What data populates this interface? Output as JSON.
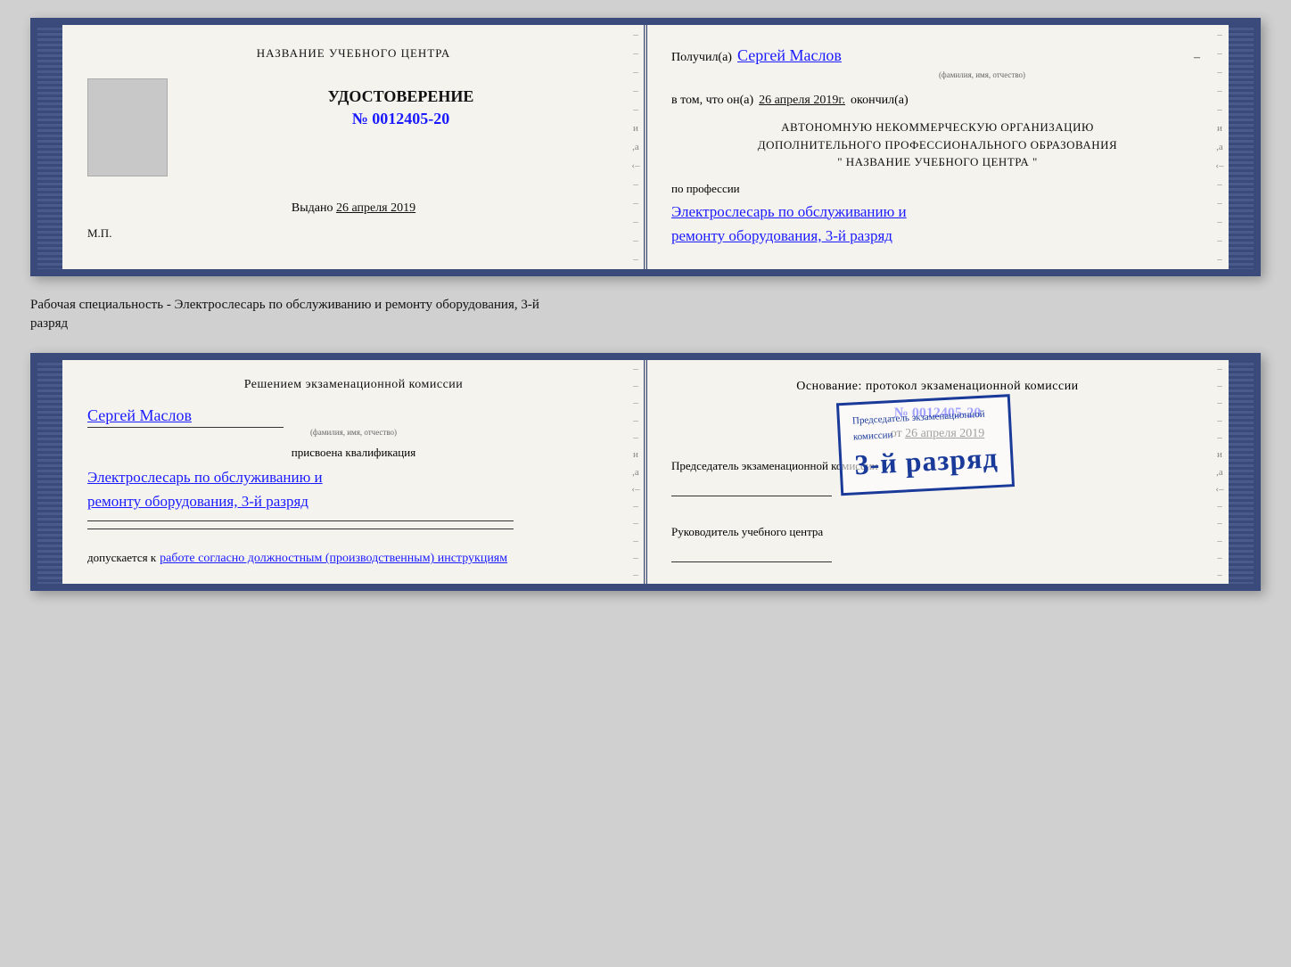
{
  "cert1": {
    "left_page": {
      "header": "НАЗВАНИЕ УЧЕБНОГО ЦЕНТРА",
      "udostoverenie": "УДОСТОВЕРЕНИЕ",
      "number": "№ 0012405-20",
      "vydano_label": "Выдано",
      "vydano_date": "26 апреля 2019",
      "mp": "М.П."
    },
    "right_page": {
      "poluchil_label": "Получил(а)",
      "poluchil_name": "Сергей Маслов",
      "fio_label": "(фамилия, имя, отчество)",
      "vtom_label": "в том, что он(а)",
      "vtom_date": "26 апреля 2019г.",
      "okончил_label": "окончил(а)",
      "org_line1": "АВТОНОМНУЮ НЕКОММЕРЧЕСКУЮ ОРГАНИЗАЦИЮ",
      "org_line2": "ДОПОЛНИТЕЛЬНОГО ПРОФЕССИОНАЛЬНОГО ОБРАЗОВАНИЯ",
      "org_line3": "\"  НАЗВАНИЕ УЧЕБНОГО ЦЕНТРА  \"",
      "po_professii": "по профессии",
      "profession_line1": "Электрослесарь по обслуживанию и",
      "profession_line2": "ремонту оборудования, 3-й разряд"
    }
  },
  "between_text": {
    "line1": "Рабочая специальность - Электрослесарь по обслуживанию и ремонту оборудования, 3-й",
    "line2": "разряд"
  },
  "cert2": {
    "left_page": {
      "resheniem": "Решением экзаменационной комиссии",
      "name": "Сергей Маслов",
      "fio_label": "(фамилия, имя, отчество)",
      "prisvoena": "присвоена квалификация",
      "profession_line1": "Электрослесарь по обслуживанию и",
      "profession_line2": "ремонту оборудования, 3-й разряд",
      "dopuskaetsya": "допускается к",
      "dopusk_text": "работе согласно должностным (производственным) инструкциям"
    },
    "right_page": {
      "osnovanie": "Основание: протокол экзаменационной комиссии",
      "number": "№ 0012405-20",
      "ot_label": "от",
      "ot_date": "26 апреля 2019",
      "predsedatel_label": "Председатель экзаменационной комиссии",
      "rukovoditel_label": "Руководитель учебного центра"
    },
    "stamp": {
      "prefix": "Председатель экзаменационной",
      "suffix": "комиссии",
      "big_text": "3-й разряд"
    }
  }
}
